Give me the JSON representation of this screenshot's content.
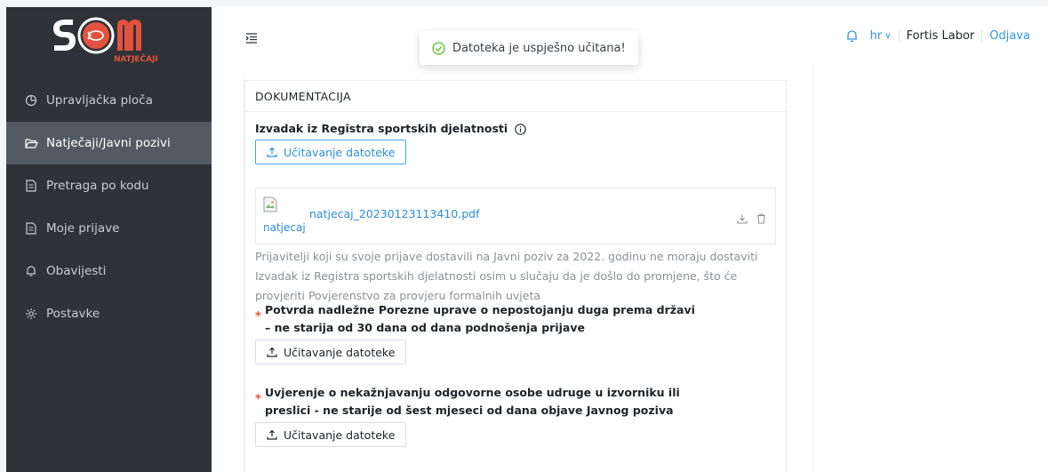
{
  "brand": {
    "name": "NATJEČAJI",
    "accent": "#e2523f"
  },
  "sidebar": {
    "items": [
      {
        "label": "Upravljačka ploča",
        "icon": "dashboard-icon",
        "active": false
      },
      {
        "label": "Natječaji/Javni pozivi",
        "icon": "folder-open-icon",
        "active": true
      },
      {
        "label": "Pretraga po kodu",
        "icon": "file-icon",
        "active": false
      },
      {
        "label": "Moje prijave",
        "icon": "file-icon",
        "active": false
      },
      {
        "label": "Obavijesti",
        "icon": "bell-icon",
        "active": false
      },
      {
        "label": "Postavke",
        "icon": "gear-icon",
        "active": false
      }
    ]
  },
  "header": {
    "lang": "hr",
    "user": "Fortis Labor",
    "logout": "Odjava"
  },
  "toast": {
    "message": "Datoteka je uspješno učitana!"
  },
  "card": {
    "title": "DOKUMENTACIJA",
    "sections": [
      {
        "title": "Izvadak iz Registra sportskih djelatnosti",
        "required": false,
        "button": "Učitavanje datoteke",
        "file": {
          "name": "natjecaj_20230123113410.pdf",
          "thumb_alt": "natjecaj_20230123113410.pdf"
        },
        "note": "Prijavitelji koji su svoje prijave dostavili na Javni poziv za 2022. godinu ne moraju dostaviti Izvadak iz Registra sportskih djelatnosti osim u slučaju da je došlo do promjene, što će provjeriti Povjerenstvo za provjeru formalnih uvjeta"
      },
      {
        "title_line1": "Potvrda nadležne Porezne uprave o nepostojanju duga prema državi",
        "title_line2": "– ne starija od 30 dana od dana podnošenja prijave",
        "required": true,
        "button": "Učitavanje datoteke"
      },
      {
        "title_line1": "Uvjerenje o nekažnjavanju odgovorne osobe udruge u izvorniku ili",
        "title_line2": "preslici - ne starije od šest mjeseci od dana objave Javnog poziva",
        "required": true,
        "button": "Učitavanje datoteke"
      }
    ]
  },
  "colors": {
    "sidebar_bg": "#2f3337",
    "sidebar_active": "#545a60",
    "link": "#2b8fd6",
    "success": "#52c41a"
  }
}
